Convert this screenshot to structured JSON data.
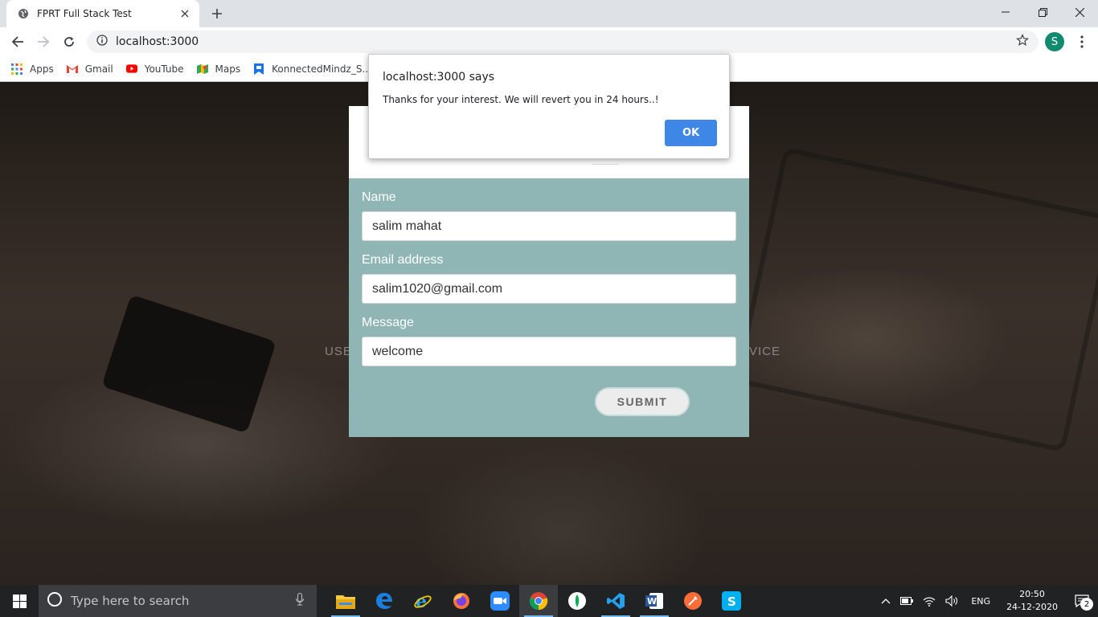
{
  "browser": {
    "tab_title": "FPRT Full Stack Test",
    "url": "localhost:3000",
    "profile_initial": "S",
    "bookmarks": [
      {
        "label": "Apps",
        "icon": "apps-grid-icon"
      },
      {
        "label": "Gmail",
        "icon": "gmail-icon"
      },
      {
        "label": "YouTube",
        "icon": "youtube-icon"
      },
      {
        "label": "Maps",
        "icon": "maps-icon"
      },
      {
        "label": "KonnectedMindz_S...",
        "icon": "bookmark-site-icon"
      }
    ]
  },
  "page": {
    "hero_left": "USE",
    "hero_right": "VICE",
    "form": {
      "name_label": "Name",
      "name_value": "salim mahat",
      "email_label": "Email address",
      "email_value": "salim1020@gmail.com",
      "message_label": "Message",
      "message_value": "welcome",
      "submit_label": "SUBMIT"
    }
  },
  "alert": {
    "title": "localhost:3000 says",
    "message": "Thanks for your interest. We will revert you in 24 hours..!",
    "ok_label": "OK"
  },
  "taskbar": {
    "search_placeholder": "Type here to search",
    "apps": [
      "file-explorer",
      "edge",
      "internet-explorer",
      "firefox",
      "zoom",
      "chrome",
      "mongodb-compass",
      "vscode",
      "word",
      "postman",
      "skype"
    ],
    "language": "ENG",
    "time": "20:50",
    "date": "24-12-2020",
    "notification_count": "2"
  },
  "colors": {
    "form_body": "#8fb5b5",
    "ok_button": "#3f87e6",
    "avatar": "#128a6e",
    "taskbar": "#202224"
  }
}
